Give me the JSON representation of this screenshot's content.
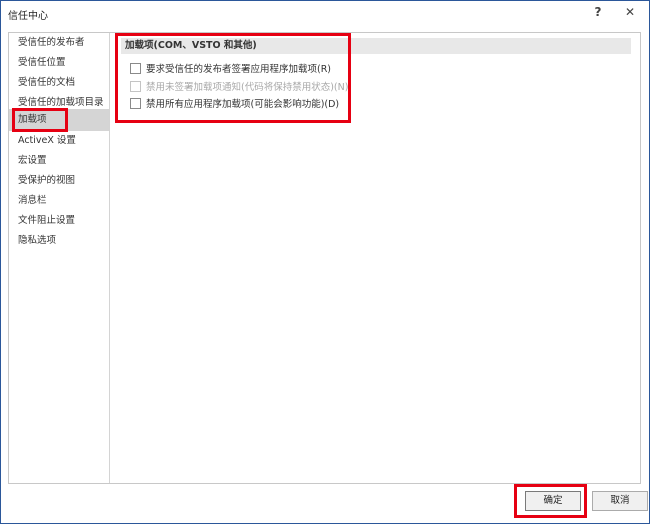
{
  "window": {
    "title": "信任中心",
    "help_glyph": "?",
    "close_glyph": "✕"
  },
  "sidebar": {
    "items": [
      {
        "label": "受信任的发布者"
      },
      {
        "label": "受信任位置"
      },
      {
        "label": "受信任的文档"
      },
      {
        "label": "受信任的加载项目录"
      },
      {
        "label": "加载项"
      },
      {
        "label": "ActiveX 设置"
      },
      {
        "label": "宏设置"
      },
      {
        "label": "受保护的视图"
      },
      {
        "label": "消息栏"
      },
      {
        "label": "文件阻止设置"
      },
      {
        "label": "隐私选项"
      }
    ],
    "selected_index": 4
  },
  "section": {
    "header": "加载项(COM、VSTO 和其他)",
    "options": [
      {
        "label": "要求受信任的发布者签署应用程序加载项(R)",
        "checked": false,
        "enabled": true
      },
      {
        "label": "禁用未签署加载项通知(代码将保持禁用状态)(N)",
        "checked": false,
        "enabled": false
      },
      {
        "label": "禁用所有应用程序加载项(可能会影响功能)(D)",
        "checked": false,
        "enabled": true
      }
    ]
  },
  "footer": {
    "ok_label": "确定",
    "cancel_label": "取消"
  },
  "colors": {
    "highlight_box": "#e60012",
    "selected_item_bg": "#d5d5d5",
    "section_header_bg": "#e8e8e8"
  }
}
